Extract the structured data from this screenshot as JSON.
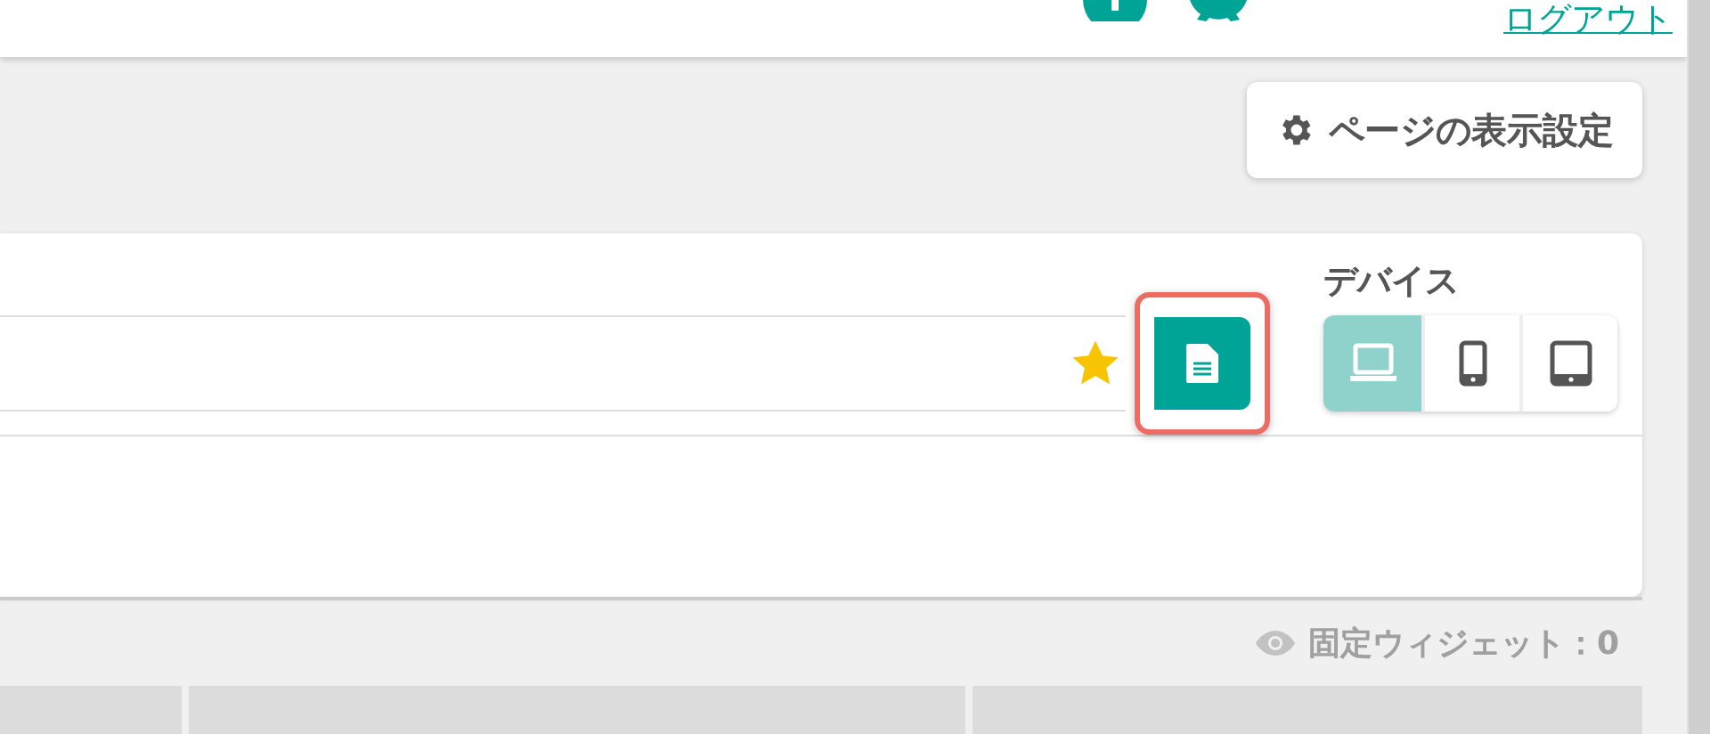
{
  "header": {
    "logout_link": "ログアウト"
  },
  "toolbar": {
    "settings_button": "ページの表示設定"
  },
  "editor": {
    "favorite": true,
    "document_button": {
      "highlighted": true
    },
    "device_label": "デバイス",
    "devices": [
      {
        "kind": "laptop",
        "selected": true
      },
      {
        "kind": "phone",
        "selected": false
      },
      {
        "kind": "tablet",
        "selected": false
      }
    ]
  },
  "widget_bar": {
    "fixed_widgets": "固定ウィジェット：0"
  }
}
